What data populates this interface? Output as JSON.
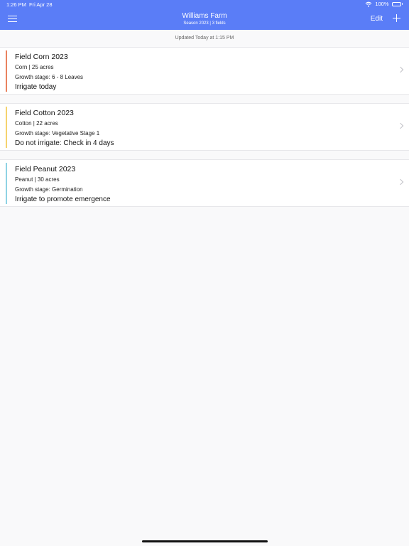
{
  "status_bar": {
    "time": "1:26 PM",
    "date": "Fri Apr 28",
    "battery": "100%",
    "battery_level": 1
  },
  "header": {
    "title": "Williams Farm",
    "subtitle": "Season 2023 | 3 fields",
    "edit_label": "Edit",
    "menu_icon": "hamburger-menu-icon",
    "add_icon": "plus-icon"
  },
  "updated": "Updated Today at 1:15 PM",
  "fields": [
    {
      "name": "Field Corn 2023",
      "crop": "Corn | 25 acres",
      "stage": "Growth stage: 6 - 8 Leaves",
      "advice": "Irrigate today",
      "color": "#e9825f"
    },
    {
      "name": "Field Cotton 2023",
      "crop": "Cotton | 22 acres",
      "stage": "Growth stage: Vegetative Stage 1",
      "advice": "Do not irrigate: Check in 4 days",
      "color": "#f5d36e"
    },
    {
      "name": "Field Peanut 2023",
      "crop": "Peanut | 30 acres",
      "stage": "Growth stage: Germination",
      "advice": "Irrigate to promote emergence",
      "color": "#8fd3e4"
    }
  ],
  "colors": {
    "header_bg": "#5a7df7",
    "background": "#f9f9fa"
  }
}
